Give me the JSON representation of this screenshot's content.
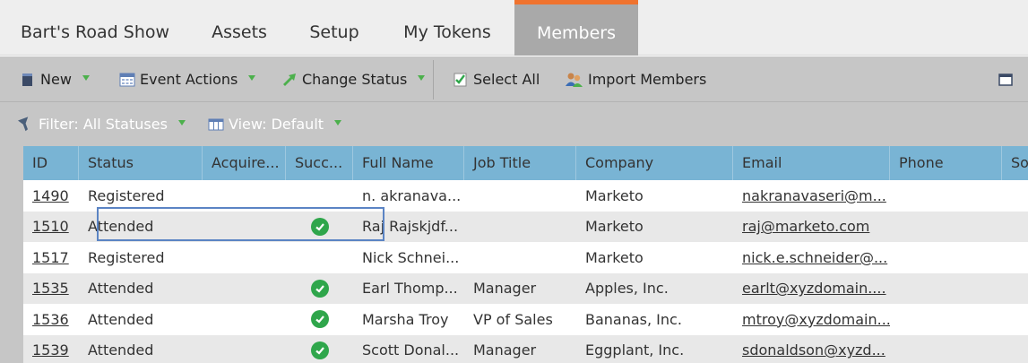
{
  "tabs": [
    {
      "label": "Bart's Road Show",
      "active": false
    },
    {
      "label": "Assets",
      "active": false
    },
    {
      "label": "Setup",
      "active": false
    },
    {
      "label": "My Tokens",
      "active": false
    },
    {
      "label": "Members",
      "active": true
    }
  ],
  "toolbar": {
    "new_label": "New",
    "event_actions_label": "Event Actions",
    "change_status_label": "Change Status",
    "select_all_label": "Select All",
    "import_members_label": "Import Members"
  },
  "filterbar": {
    "filter_label": "Filter: All Statuses",
    "view_label": "View: Default"
  },
  "grid": {
    "columns": [
      "ID",
      "Status",
      "Acquire...",
      "Succ...",
      "Full Name",
      "Job Title",
      "Company",
      "Email",
      "Phone",
      "So"
    ],
    "rows": [
      {
        "id": "1490",
        "status": "Registered",
        "acquired": "",
        "success": false,
        "full_name": "n. akranava...",
        "job_title": "",
        "company": "Marketo",
        "email": "nakranavaseri@m...",
        "phone": ""
      },
      {
        "id": "1510",
        "status": "Attended",
        "acquired": "",
        "success": true,
        "full_name": "Raj Rajskjdf...",
        "job_title": "",
        "company": "Marketo",
        "email": "raj@marketo.com",
        "phone": ""
      },
      {
        "id": "1517",
        "status": "Registered",
        "acquired": "",
        "success": false,
        "full_name": "Nick Schnei...",
        "job_title": "",
        "company": "Marketo",
        "email": "nick.e.schneider@...",
        "phone": ""
      },
      {
        "id": "1535",
        "status": "Attended",
        "acquired": "",
        "success": true,
        "full_name": "Earl Thomp...",
        "job_title": "Manager",
        "company": "Apples, Inc.",
        "email": "earlt@xyzdomain....",
        "phone": ""
      },
      {
        "id": "1536",
        "status": "Attended",
        "acquired": "",
        "success": true,
        "full_name": "Marsha Troy",
        "job_title": "VP of Sales",
        "company": "Bananas, Inc.",
        "email": "mtroy@xyzdomain...",
        "phone": ""
      },
      {
        "id": "1539",
        "status": "Attended",
        "acquired": "",
        "success": true,
        "full_name": "Scott Donal...",
        "job_title": "Manager",
        "company": "Eggplant, Inc.",
        "email": "sdonaldson@xyzd...",
        "phone": ""
      }
    ]
  },
  "colors": {
    "active_tab_accent": "#f0732e",
    "header_blue": "#79b4d4",
    "success_green": "#2fa64b",
    "highlight_border": "#5b84c4"
  }
}
